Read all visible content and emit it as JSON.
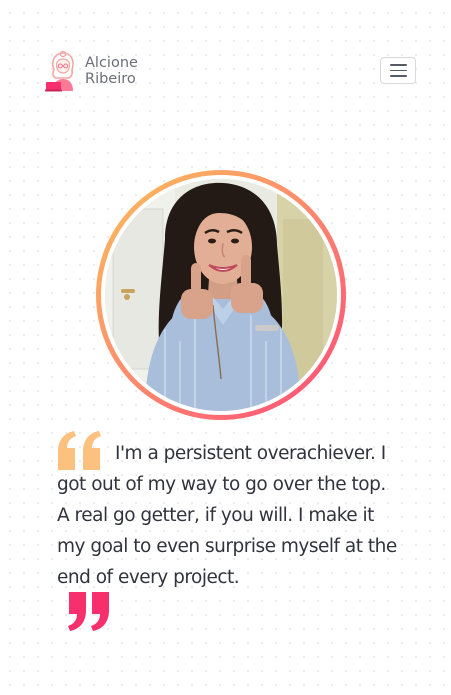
{
  "brand": {
    "name_line1": "Alcione",
    "name_line2": "Ribeiro",
    "logo_icon": "girl-avatar-icon"
  },
  "nav": {
    "menu_icon": "hamburger-menu-icon"
  },
  "portrait": {
    "ring_colors": [
      "#fbbf5b",
      "#fd8f6c",
      "#fd4b78"
    ]
  },
  "quote": {
    "text": "I'm a persistent overachiever. I got out of my way to go over the top. A real go getter, if you will. I make it my goal to even surprise myself at the end of every project.",
    "open_mark_color": "#fcc07f",
    "close_mark_color": "#f7306d"
  }
}
